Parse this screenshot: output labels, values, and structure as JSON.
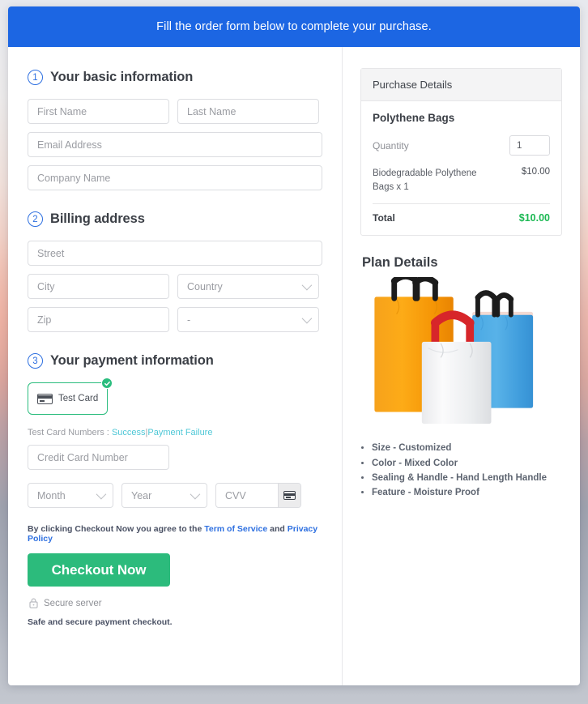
{
  "banner": {
    "text": "Fill the order form below to complete your purchase."
  },
  "sections": {
    "basic": {
      "number": "1",
      "title": "Your basic information"
    },
    "billing": {
      "number": "2",
      "title": "Billing address"
    },
    "payment": {
      "number": "3",
      "title": "Your payment information"
    }
  },
  "fields": {
    "first_name": {
      "placeholder": "First Name",
      "value": ""
    },
    "last_name": {
      "placeholder": "Last Name",
      "value": ""
    },
    "email": {
      "placeholder": "Email Address",
      "value": ""
    },
    "company": {
      "placeholder": "Company Name",
      "value": ""
    },
    "street": {
      "placeholder": "Street",
      "value": ""
    },
    "city": {
      "placeholder": "City",
      "value": ""
    },
    "country": {
      "placeholder": "Country",
      "value": ""
    },
    "zip": {
      "placeholder": "Zip",
      "value": ""
    },
    "state": {
      "placeholder": "-",
      "value": ""
    },
    "credit_card": {
      "placeholder": "Credit Card Number",
      "value": ""
    },
    "month": {
      "placeholder": "Month",
      "value": ""
    },
    "year": {
      "placeholder": "Year",
      "value": ""
    },
    "cvv": {
      "placeholder": "CVV",
      "value": ""
    }
  },
  "payment": {
    "card_tile_label": "Test Card",
    "test_card_prefix": "Test Card Numbers :",
    "link_success": "Success",
    "link_separator": "|",
    "link_failure": "Payment Failure"
  },
  "terms": {
    "prefix": "By clicking Checkout Now you agree to the",
    "link_tos": "Term of Service",
    "conjunction": "and",
    "link_privacy": "Privacy Policy"
  },
  "actions": {
    "checkout_label": "Checkout Now",
    "secure_label": "Secure server",
    "safe_note": "Safe and secure payment checkout."
  },
  "purchase": {
    "panel_title": "Purchase Details",
    "product_name": "Polythene Bags",
    "quantity_label": "Quantity",
    "quantity_value": "1",
    "line_item_desc": "Biodegradable Polythene Bags x 1",
    "line_item_amount": "$10.00",
    "total_label": "Total",
    "total_amount": "$10.00"
  },
  "plan": {
    "title": "Plan Details",
    "features": [
      "Size - Customized",
      "Color - Mixed Color",
      "Sealing & Handle - Hand Length Handle",
      "Feature - Moisture Proof"
    ]
  },
  "colors": {
    "banner_blue": "#1c66e3",
    "accent_blue": "#2d6fe0",
    "success_green": "#2cbb7c",
    "total_green": "#1db954",
    "link_teal": "#4ec7d6"
  }
}
